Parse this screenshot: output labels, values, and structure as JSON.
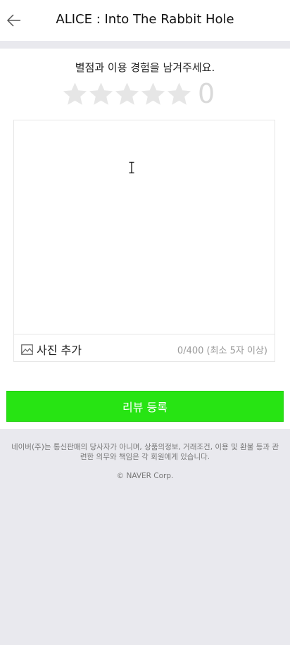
{
  "header": {
    "title": "ALICE : Into The Rabbit Hole",
    "back_icon": "arrow-left-icon"
  },
  "review": {
    "prompt": "별점과 이용 경험을 남겨주세요.",
    "rating": {
      "max_stars": 5,
      "selected": 0,
      "score": "0",
      "star_color_empty": "#e6e6e6"
    },
    "textarea_value": "",
    "add_photo_label": "사진 추가",
    "photo_icon": "image-icon",
    "char_count": "0/400 (최소 5자 이상)"
  },
  "submit": {
    "label": "리뷰 등록",
    "color": "#27e413"
  },
  "footer": {
    "disclaimer": "네이버(주)는 통신판매의 당사자가 아니며, 상품의정보, 거래조건, 이용 및 환불 등과 관련한 의무와 책임은 각 회원에게 있습니다.",
    "copyright": "© NAVER Corp."
  }
}
